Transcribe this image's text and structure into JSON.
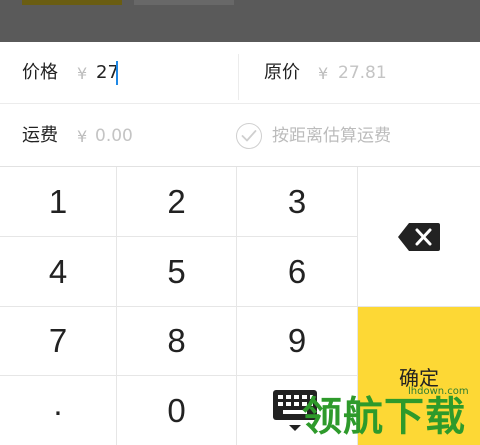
{
  "form": {
    "price": {
      "label": "价格",
      "currency": "¥",
      "value": "27"
    },
    "original_price": {
      "label": "原价",
      "currency": "¥",
      "placeholder": "27.81"
    },
    "shipping": {
      "label": "运费",
      "currency": "¥",
      "placeholder": "0.00"
    },
    "estimate_shipping": {
      "label": "按距离估算运费",
      "checked": false
    }
  },
  "keypad": {
    "keys": [
      "1",
      "2",
      "3",
      "4",
      "5",
      "6",
      "7",
      "8",
      "9",
      ".",
      "0"
    ],
    "delete_icon": "backspace-icon",
    "hide_icon": "keyboard-hide-icon",
    "confirm_label": "确定"
  },
  "watermark": {
    "url": "lhdown.com",
    "text": "领航下载"
  },
  "colors": {
    "accent_yellow": "#fdd835",
    "caret_blue": "#1f88e5",
    "overlay_dim": "#5a5a5a"
  }
}
